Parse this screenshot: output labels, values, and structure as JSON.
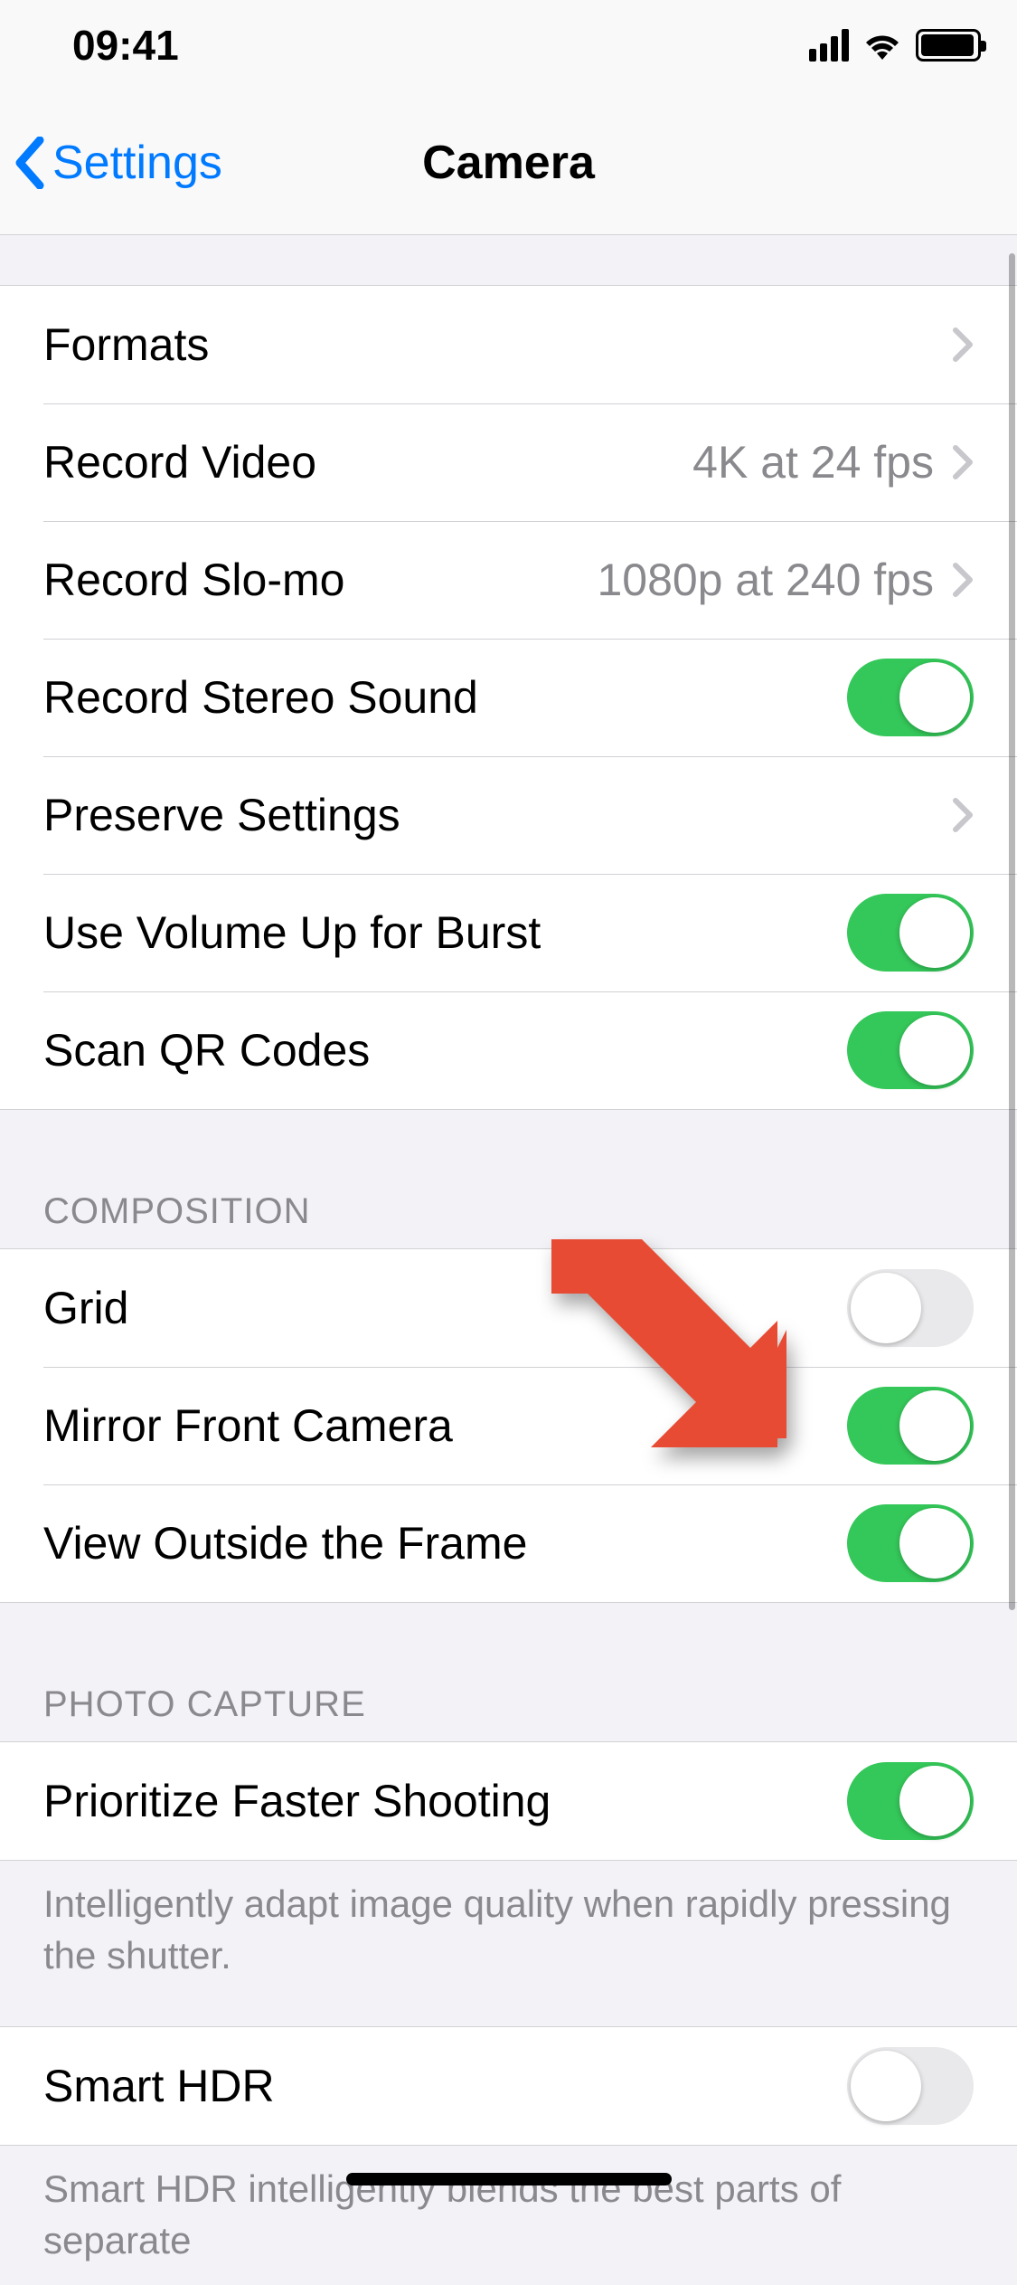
{
  "status": {
    "time": "09:41"
  },
  "nav": {
    "back_label": "Settings",
    "title": "Camera"
  },
  "section1": {
    "rows": {
      "formats": {
        "label": "Formats"
      },
      "record_video": {
        "label": "Record Video",
        "value": "4K at 24 fps"
      },
      "record_slomo": {
        "label": "Record Slo-mo",
        "value": "1080p at 240 fps"
      },
      "stereo_sound": {
        "label": "Record Stereo Sound",
        "on": true
      },
      "preserve": {
        "label": "Preserve Settings"
      },
      "volume_burst": {
        "label": "Use Volume Up for Burst",
        "on": true
      },
      "scan_qr": {
        "label": "Scan QR Codes",
        "on": true
      }
    }
  },
  "section2": {
    "header": "COMPOSITION",
    "rows": {
      "grid": {
        "label": "Grid",
        "on": false
      },
      "mirror_front": {
        "label": "Mirror Front Camera",
        "on": true
      },
      "view_outside": {
        "label": "View Outside the Frame",
        "on": true
      }
    }
  },
  "section3": {
    "header": "PHOTO CAPTURE",
    "rows": {
      "prioritize": {
        "label": "Prioritize Faster Shooting",
        "on": true
      }
    },
    "footer": "Intelligently adapt image quality when rapidly pressing the shutter."
  },
  "section4": {
    "rows": {
      "smart_hdr": {
        "label": "Smart HDR",
        "on": false
      }
    },
    "footer_partial": "Smart HDR intelligently blends the best parts of separate"
  },
  "annotation": {
    "arrow_color": "#e84b33"
  }
}
